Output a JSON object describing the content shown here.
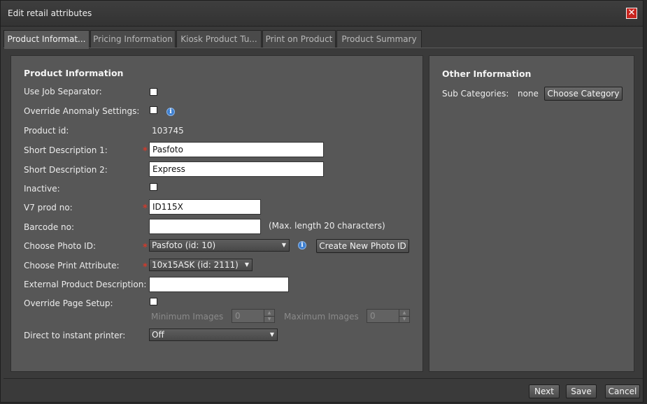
{
  "window": {
    "title": "Edit retail attributes",
    "close_icon": "close-icon"
  },
  "tabs": [
    {
      "label": "Product Informat...",
      "active": true
    },
    {
      "label": "Pricing Information",
      "active": false
    },
    {
      "label": "Kiosk Product Tu...",
      "active": false
    },
    {
      "label": "Print on Product",
      "active": false
    },
    {
      "label": "Product Summary",
      "active": false
    }
  ],
  "product_info": {
    "title": "Product Information",
    "use_job_separator": {
      "label": "Use Job Separator:"
    },
    "override_anomaly": {
      "label": "Override Anomaly Settings:"
    },
    "product_id": {
      "label": "Product id:",
      "value": "103745"
    },
    "short_desc_1": {
      "label": "Short Description 1:",
      "value": "Pasfoto"
    },
    "short_desc_2": {
      "label": "Short Description 2:",
      "value": "Express"
    },
    "inactive": {
      "label": "Inactive:"
    },
    "v7_prod_no": {
      "label": "V7 prod no:",
      "value": "ID115X"
    },
    "barcode_no": {
      "label": "Barcode no:",
      "value": "",
      "hint": "(Max. length 20 characters)"
    },
    "photo_id": {
      "label": "Choose Photo ID:",
      "selected": "Pasfoto (id: 10)",
      "create_button": "Create New Photo ID"
    },
    "print_attribute": {
      "label": "Choose Print Attribute:",
      "selected": "10x15ASK (id: 2111)"
    },
    "external_desc": {
      "label": "External Product Description:",
      "value": ""
    },
    "override_page_setup": {
      "label": "Override Page Setup:"
    },
    "min_images": {
      "label": "Minimum Images",
      "value": "0"
    },
    "max_images": {
      "label": "Maximum Images",
      "value": "0"
    },
    "instant_printer": {
      "label": "Direct to instant printer:",
      "selected": "Off"
    },
    "required_mark": "*"
  },
  "other_info": {
    "title": "Other Information",
    "sub_categories": {
      "label": "Sub Categories:",
      "value": "none"
    },
    "choose_category_button": "Choose Category"
  },
  "footer": {
    "next": "Next",
    "save": "Save",
    "cancel": "Cancel"
  },
  "colors": {
    "required": "#d23a2b",
    "close": "#c8251f",
    "info": "#3d7fd0"
  }
}
